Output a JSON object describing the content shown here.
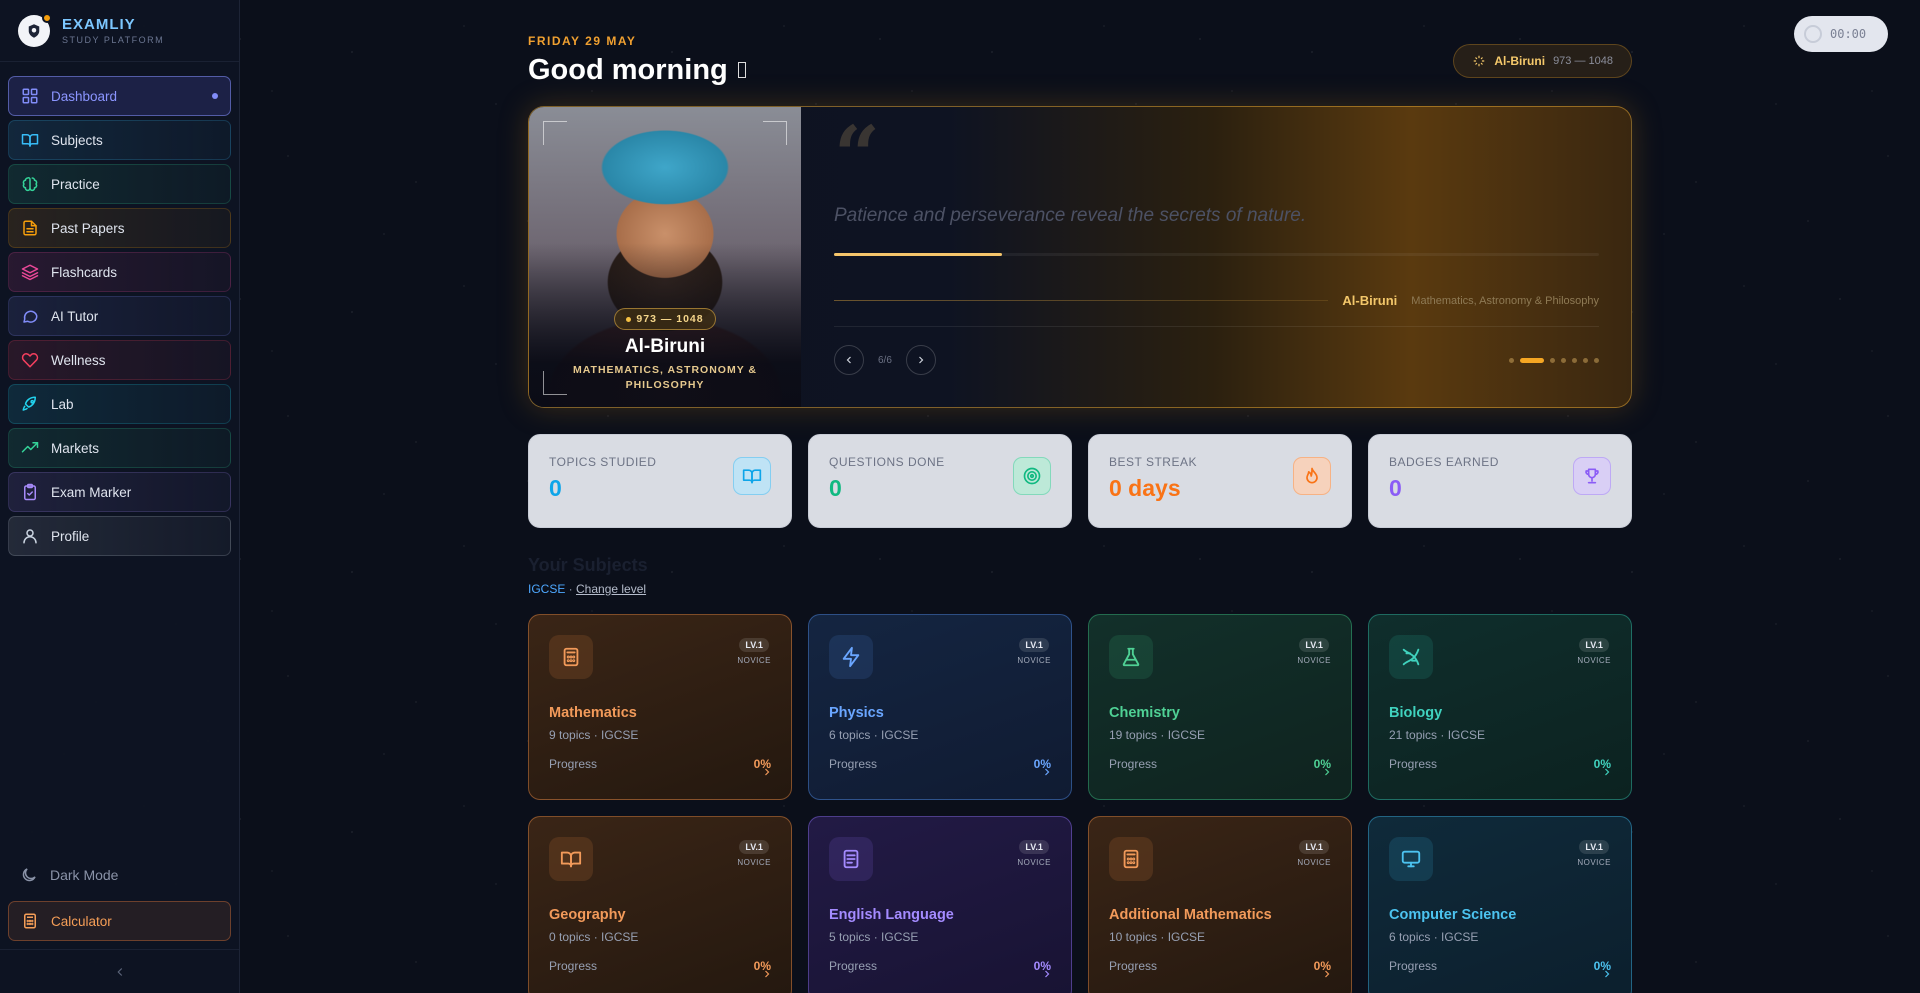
{
  "brand": {
    "name": "EXAMLIY",
    "subtitle": "STUDY PLATFORM"
  },
  "nav": {
    "items": [
      {
        "label": "Dashboard",
        "icon": "dashboard-icon",
        "color": "#818cf8",
        "active": true
      },
      {
        "label": "Subjects",
        "icon": "book-open-icon",
        "color": "#38bdf8"
      },
      {
        "label": "Practice",
        "icon": "brain-icon",
        "color": "#34d399"
      },
      {
        "label": "Past Papers",
        "icon": "file-text-icon",
        "color": "#f59e0b"
      },
      {
        "label": "Flashcards",
        "icon": "layers-icon",
        "color": "#ec4899"
      },
      {
        "label": "AI Tutor",
        "icon": "message-icon",
        "color": "#818cf8"
      },
      {
        "label": "Wellness",
        "icon": "heart-icon",
        "color": "#f43f5e"
      },
      {
        "label": "Lab",
        "icon": "rocket-icon",
        "color": "#22d3ee"
      },
      {
        "label": "Markets",
        "icon": "trending-up-icon",
        "color": "#34d399"
      },
      {
        "label": "Exam Marker",
        "icon": "clipboard-check-icon",
        "color": "#a78bfa"
      },
      {
        "label": "Profile",
        "icon": "user-icon",
        "color": "#cbd5e1"
      }
    ]
  },
  "sidebar_bottom": {
    "dark_mode": "Dark Mode",
    "calculator": "Calculator"
  },
  "timer": {
    "value": "00:00"
  },
  "header": {
    "date": "FRIDAY 29 MAY",
    "greeting": "Good morning",
    "scholar_pill": {
      "name": "Al-Biruni",
      "years": "973 — 1048"
    }
  },
  "quote": {
    "years": "973 — 1048",
    "name": "Al-Biruni",
    "field": "MATHEMATICS, ASTRONOMY & PHILOSOPHY",
    "quote_mark": "“",
    "text": "Patience and perseverance reveal the secrets of nature.",
    "author": "Al-Biruni",
    "author_field": "Mathematics, Astronomy & Philosophy",
    "counter": "6/6",
    "progress": 0.22,
    "dots": 7,
    "active_dot": 1
  },
  "stats": [
    {
      "label": "TOPICS STUDIED",
      "value": "0",
      "color": "#0ea5e9",
      "icon": "book-open-icon",
      "bg": "#bfe3f5"
    },
    {
      "label": "QUESTIONS DONE",
      "value": "0",
      "color": "#10b981",
      "icon": "target-icon",
      "bg": "#bde9d8"
    },
    {
      "label": "BEST STREAK",
      "value": "0 days",
      "color": "#f97316",
      "icon": "flame-icon",
      "bg": "#f6d2bc"
    },
    {
      "label": "BADGES EARNED",
      "value": "0",
      "color": "#8b5cf6",
      "icon": "trophy-icon",
      "bg": "#d9cff5"
    }
  ],
  "subjects_section": {
    "title": "Your Subjects",
    "level": "IGCSE",
    "separator": " · ",
    "change": "Change level"
  },
  "subjects": [
    {
      "name": "Mathematics",
      "meta": "9 topics · IGCSE",
      "progress_label": "Progress",
      "pct": "0%",
      "level": "LV.1",
      "rank": "NOVICE",
      "theme": "c-orange",
      "icon": "calculator-icon"
    },
    {
      "name": "Physics",
      "meta": "6 topics · IGCSE",
      "progress_label": "Progress",
      "pct": "0%",
      "level": "LV.1",
      "rank": "NOVICE",
      "theme": "c-blue",
      "icon": "zap-icon"
    },
    {
      "name": "Chemistry",
      "meta": "19 topics · IGCSE",
      "progress_label": "Progress",
      "pct": "0%",
      "level": "LV.1",
      "rank": "NOVICE",
      "theme": "c-green",
      "icon": "flask-icon"
    },
    {
      "name": "Biology",
      "meta": "21 topics · IGCSE",
      "progress_label": "Progress",
      "pct": "0%",
      "level": "LV.1",
      "rank": "NOVICE",
      "theme": "c-teal",
      "icon": "dna-icon"
    },
    {
      "name": "Geography",
      "meta": "0 topics · IGCSE",
      "progress_label": "Progress",
      "pct": "0%",
      "level": "LV.1",
      "rank": "NOVICE",
      "theme": "c-orange",
      "icon": "map-book-icon"
    },
    {
      "name": "English Language",
      "meta": "5 topics · IGCSE",
      "progress_label": "Progress",
      "pct": "0%",
      "level": "LV.1",
      "rank": "NOVICE",
      "theme": "c-purple",
      "icon": "document-icon"
    },
    {
      "name": "Additional Mathematics",
      "meta": "10 topics · IGCSE",
      "progress_label": "Progress",
      "pct": "0%",
      "level": "LV.1",
      "rank": "NOVICE",
      "theme": "c-orange",
      "icon": "calculator-icon"
    },
    {
      "name": "Computer Science",
      "meta": "6 topics · IGCSE",
      "progress_label": "Progress",
      "pct": "0%",
      "level": "LV.1",
      "rank": "NOVICE",
      "theme": "c-cyan",
      "icon": "monitor-icon"
    }
  ]
}
